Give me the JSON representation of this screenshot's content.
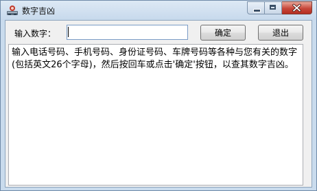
{
  "window": {
    "title": "数字吉凶"
  },
  "icons": {
    "app": "app-icon",
    "minimize": "minimize-icon",
    "maximize": "maximize-icon",
    "close": "close-icon"
  },
  "form": {
    "input_label": "输入数字：",
    "input_value": "",
    "ok_label": "确定",
    "exit_label": "退出"
  },
  "output": {
    "text": "输入电话号码、手机号码、身份证号码、车牌号码等各种与您有关的数字(包括英文26个字母)，然后按回车或点击'确定'按钮，以查其数字吉凶。"
  },
  "colors": {
    "close_button": "#c7473a",
    "title_bar": "#c7d9ec"
  }
}
